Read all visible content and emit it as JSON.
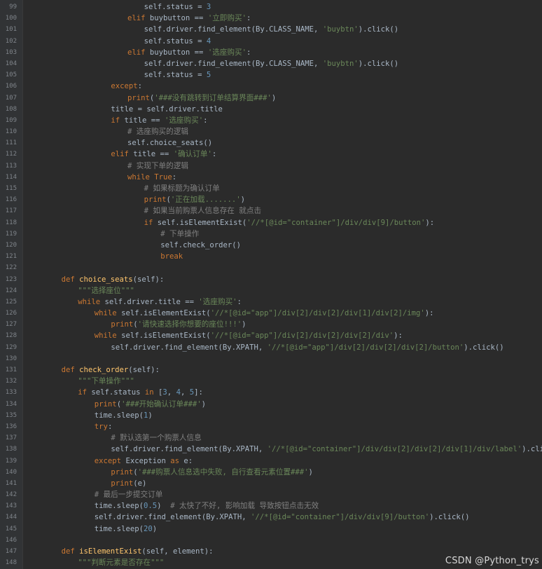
{
  "watermark": "CSDN @Python_trys",
  "lines": [
    {
      "n": "99",
      "indent": 6,
      "tokens": [
        [
          "self",
          "self.status = "
        ],
        [
          "num",
          "3"
        ]
      ]
    },
    {
      "n": "100",
      "indent": 5,
      "tokens": [
        [
          "kw",
          "elif "
        ],
        [
          "bi",
          "buybutton == "
        ],
        [
          "str",
          "'立即购买'"
        ],
        [
          "bi",
          ":"
        ]
      ]
    },
    {
      "n": "101",
      "indent": 6,
      "tokens": [
        [
          "bi",
          "self.driver.find_element(By.CLASS_NAME, "
        ],
        [
          "str",
          "'buybtn'"
        ],
        [
          "bi",
          ").click()"
        ]
      ]
    },
    {
      "n": "102",
      "indent": 6,
      "tokens": [
        [
          "bi",
          "self.status = "
        ],
        [
          "num",
          "4"
        ]
      ]
    },
    {
      "n": "103",
      "indent": 5,
      "tokens": [
        [
          "kw",
          "elif "
        ],
        [
          "bi",
          "buybutton == "
        ],
        [
          "str",
          "'选座购买'"
        ],
        [
          "bi",
          ":"
        ]
      ]
    },
    {
      "n": "104",
      "indent": 6,
      "tokens": [
        [
          "bi",
          "self.driver.find_element(By.CLASS_NAME, "
        ],
        [
          "str",
          "'buybtn'"
        ],
        [
          "bi",
          ").click()"
        ]
      ]
    },
    {
      "n": "105",
      "indent": 6,
      "tokens": [
        [
          "bi",
          "self.status = "
        ],
        [
          "num",
          "5"
        ]
      ]
    },
    {
      "n": "106",
      "indent": 4,
      "tokens": [
        [
          "kw",
          "except"
        ],
        [
          "bi",
          ":"
        ]
      ]
    },
    {
      "n": "107",
      "indent": 5,
      "tokens": [
        [
          "kw",
          "print"
        ],
        [
          "bi",
          "("
        ],
        [
          "str",
          "'###没有跳转到订单结算界面###'"
        ],
        [
          "bi",
          ")"
        ]
      ]
    },
    {
      "n": "108",
      "indent": 4,
      "tokens": [
        [
          "bi",
          "title = self.driver.title"
        ]
      ]
    },
    {
      "n": "109",
      "indent": 4,
      "tokens": [
        [
          "kw",
          "if "
        ],
        [
          "bi",
          "title == "
        ],
        [
          "str",
          "'选座购买'"
        ],
        [
          "bi",
          ":"
        ]
      ]
    },
    {
      "n": "110",
      "indent": 5,
      "tokens": [
        [
          "cm",
          "# 选座购买的逻辑"
        ]
      ]
    },
    {
      "n": "111",
      "indent": 5,
      "tokens": [
        [
          "bi",
          "self.choice_seats()"
        ]
      ]
    },
    {
      "n": "112",
      "indent": 4,
      "tokens": [
        [
          "kw",
          "elif "
        ],
        [
          "bi",
          "title == "
        ],
        [
          "str",
          "'确认订单'"
        ],
        [
          "bi",
          ":"
        ]
      ]
    },
    {
      "n": "113",
      "indent": 5,
      "tokens": [
        [
          "cm",
          "# 实现下单的逻辑"
        ]
      ]
    },
    {
      "n": "114",
      "indent": 5,
      "tokens": [
        [
          "kw",
          "while "
        ],
        [
          "kw",
          "True"
        ],
        [
          "bi",
          ":"
        ]
      ]
    },
    {
      "n": "115",
      "indent": 6,
      "tokens": [
        [
          "cm",
          "# 如果标题为确认订单"
        ]
      ]
    },
    {
      "n": "116",
      "indent": 6,
      "tokens": [
        [
          "kw",
          "print"
        ],
        [
          "bi",
          "("
        ],
        [
          "str",
          "'正在加载.......'"
        ],
        [
          "bi",
          ")"
        ]
      ]
    },
    {
      "n": "117",
      "indent": 6,
      "tokens": [
        [
          "cm",
          "# 如果当前购票人信息存在 就点击"
        ]
      ]
    },
    {
      "n": "118",
      "indent": 6,
      "tokens": [
        [
          "kw",
          "if "
        ],
        [
          "bi",
          "self.isElementExist("
        ],
        [
          "str",
          "'//*[@id=\"container\"]/div/div[9]/button'"
        ],
        [
          "bi",
          "):"
        ]
      ]
    },
    {
      "n": "119",
      "indent": 7,
      "tokens": [
        [
          "cm",
          "# 下单操作"
        ]
      ]
    },
    {
      "n": "120",
      "indent": 7,
      "tokens": [
        [
          "bi",
          "self.check_order()"
        ]
      ]
    },
    {
      "n": "121",
      "indent": 7,
      "tokens": [
        [
          "kw",
          "break"
        ]
      ]
    },
    {
      "n": "122",
      "indent": 0,
      "tokens": []
    },
    {
      "n": "123",
      "indent": 1,
      "tokens": [
        [
          "kw",
          "def "
        ],
        [
          "fn",
          "choice_seats"
        ],
        [
          "bi",
          "(self):"
        ]
      ]
    },
    {
      "n": "124",
      "indent": 2,
      "tokens": [
        [
          "str",
          "\"\"\"选择座位\"\"\""
        ]
      ]
    },
    {
      "n": "125",
      "indent": 2,
      "tokens": [
        [
          "kw",
          "while "
        ],
        [
          "bi",
          "self.driver.title == "
        ],
        [
          "str",
          "'选座购买'"
        ],
        [
          "bi",
          ":"
        ]
      ]
    },
    {
      "n": "126",
      "indent": 3,
      "tokens": [
        [
          "kw",
          "while "
        ],
        [
          "bi",
          "self.isElementExist("
        ],
        [
          "str",
          "'//*[@id=\"app\"]/div[2]/div[2]/div[1]/div[2]/img'"
        ],
        [
          "bi",
          "):"
        ]
      ]
    },
    {
      "n": "127",
      "indent": 4,
      "tokens": [
        [
          "kw",
          "print"
        ],
        [
          "bi",
          "("
        ],
        [
          "str",
          "'请快速选择你想要的座位!!!'"
        ],
        [
          "bi",
          ")"
        ]
      ]
    },
    {
      "n": "128",
      "indent": 3,
      "tokens": [
        [
          "kw",
          "while "
        ],
        [
          "bi",
          "self.isElementExist("
        ],
        [
          "str",
          "'//*[@id=\"app\"]/div[2]/div[2]/div[2]/div'"
        ],
        [
          "bi",
          "):"
        ]
      ]
    },
    {
      "n": "129",
      "indent": 4,
      "tokens": [
        [
          "bi",
          "self.driver.find_element(By.XPATH, "
        ],
        [
          "str",
          "'//*[@id=\"app\"]/div[2]/div[2]/div[2]/button'"
        ],
        [
          "bi",
          ").click()"
        ]
      ]
    },
    {
      "n": "130",
      "indent": 0,
      "tokens": []
    },
    {
      "n": "131",
      "indent": 1,
      "tokens": [
        [
          "kw",
          "def "
        ],
        [
          "fn",
          "check_order"
        ],
        [
          "bi",
          "(self):"
        ]
      ]
    },
    {
      "n": "132",
      "indent": 2,
      "tokens": [
        [
          "str",
          "\"\"\"下单操作\"\"\""
        ]
      ]
    },
    {
      "n": "133",
      "indent": 2,
      "tokens": [
        [
          "kw",
          "if "
        ],
        [
          "bi",
          "self.status "
        ],
        [
          "kw",
          "in "
        ],
        [
          "bi",
          "["
        ],
        [
          "num",
          "3"
        ],
        [
          "bi",
          ", "
        ],
        [
          "num",
          "4"
        ],
        [
          "bi",
          ", "
        ],
        [
          "num",
          "5"
        ],
        [
          "bi",
          "]:"
        ]
      ]
    },
    {
      "n": "134",
      "indent": 3,
      "tokens": [
        [
          "kw",
          "print"
        ],
        [
          "bi",
          "("
        ],
        [
          "str",
          "'###开始确认订单###'"
        ],
        [
          "bi",
          ")"
        ]
      ]
    },
    {
      "n": "135",
      "indent": 3,
      "tokens": [
        [
          "bi",
          "time.sleep("
        ],
        [
          "num",
          "1"
        ],
        [
          "bi",
          ")"
        ]
      ]
    },
    {
      "n": "136",
      "indent": 3,
      "tokens": [
        [
          "kw",
          "try"
        ],
        [
          "bi",
          ":"
        ]
      ]
    },
    {
      "n": "137",
      "indent": 4,
      "tokens": [
        [
          "cm",
          "# 默认选第一个购票人信息"
        ]
      ]
    },
    {
      "n": "138",
      "indent": 4,
      "tokens": [
        [
          "bi",
          "self.driver.find_element(By.XPATH, "
        ],
        [
          "str",
          "'//*[@id=\"container\"]/div/div[2]/div[2]/div[1]/div/label'"
        ],
        [
          "bi",
          ").click()"
        ]
      ]
    },
    {
      "n": "139",
      "indent": 3,
      "tokens": [
        [
          "kw",
          "except "
        ],
        [
          "bi",
          "Exception "
        ],
        [
          "kw",
          "as "
        ],
        [
          "bi",
          "e:"
        ]
      ]
    },
    {
      "n": "140",
      "indent": 4,
      "tokens": [
        [
          "kw",
          "print"
        ],
        [
          "bi",
          "("
        ],
        [
          "str",
          "'###购票人信息选中失败, 自行查看元素位置###'"
        ],
        [
          "bi",
          ")"
        ]
      ]
    },
    {
      "n": "141",
      "indent": 4,
      "tokens": [
        [
          "kw",
          "print"
        ],
        [
          "bi",
          "(e)"
        ]
      ]
    },
    {
      "n": "142",
      "indent": 3,
      "tokens": [
        [
          "cm",
          "# 最后一步提交订单"
        ]
      ]
    },
    {
      "n": "143",
      "indent": 3,
      "tokens": [
        [
          "bi",
          "time.sleep("
        ],
        [
          "num",
          "0.5"
        ],
        [
          "bi",
          ")  "
        ],
        [
          "cm",
          "# 太快了不好, 影响加载 导致按钮点击无效"
        ]
      ]
    },
    {
      "n": "144",
      "indent": 3,
      "tokens": [
        [
          "bi",
          "self.driver.find_element(By.XPATH, "
        ],
        [
          "str",
          "'//*[@id=\"container\"]/div/div[9]/button'"
        ],
        [
          "bi",
          ").click()"
        ]
      ]
    },
    {
      "n": "145",
      "indent": 3,
      "tokens": [
        [
          "bi",
          "time.sleep("
        ],
        [
          "num",
          "20"
        ],
        [
          "bi",
          ")"
        ]
      ]
    },
    {
      "n": "146",
      "indent": 0,
      "tokens": []
    },
    {
      "n": "147",
      "indent": 1,
      "tokens": [
        [
          "kw",
          "def "
        ],
        [
          "fn",
          "isElementExist"
        ],
        [
          "bi",
          "(self, element):"
        ]
      ]
    },
    {
      "n": "148",
      "indent": 2,
      "tokens": [
        [
          "str",
          "\"\"\"判断元素是否存在\"\"\""
        ]
      ]
    }
  ]
}
